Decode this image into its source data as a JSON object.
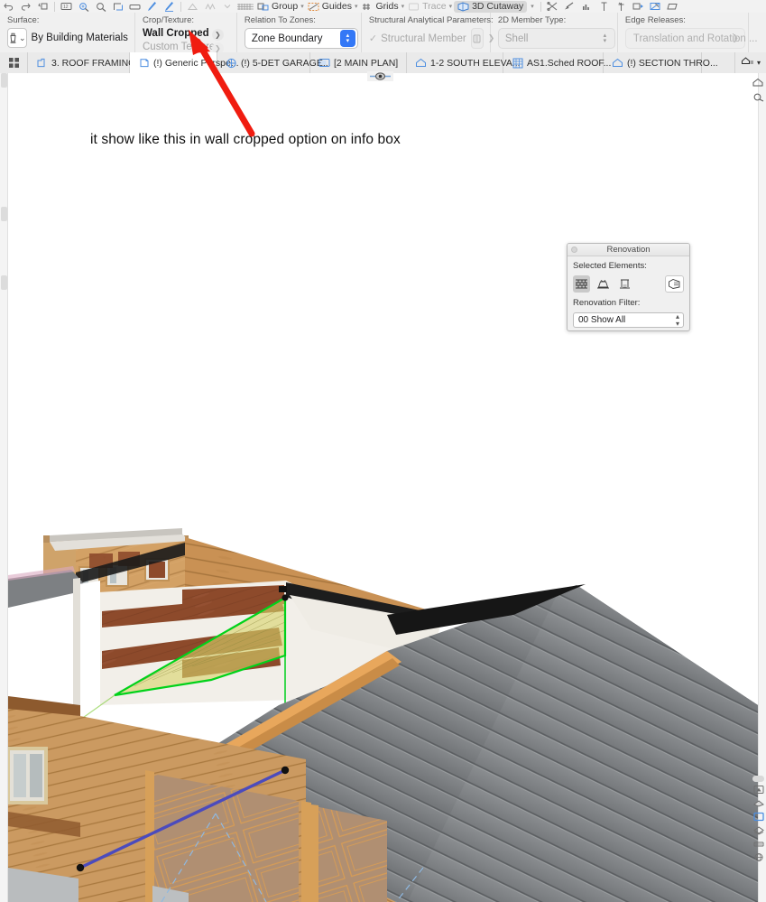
{
  "toolbar": {
    "groups": [
      {
        "label": "Group",
        "icon": "group-icon",
        "has_chevron": true,
        "dim": false
      },
      {
        "label": "Guides",
        "icon": "guides-icon",
        "has_chevron": true,
        "dim": false
      },
      {
        "label": "Grids",
        "icon": "grids-icon",
        "has_chevron": true,
        "dim": false
      },
      {
        "label": "Trace",
        "icon": "trace-icon",
        "has_chevron": true,
        "dim": true
      },
      {
        "label": "3D Cutaway",
        "icon": "cutaway-icon",
        "has_chevron": true,
        "dim": false,
        "active": true
      }
    ],
    "left_icons": [
      "undo-icon",
      "redo-icon",
      "dimension-icon",
      "zoom-fit-icon",
      "zoom-find-icon",
      "marquee-icon",
      "drawer-icon",
      "pen-icon",
      "pen-alt-icon"
    ],
    "mid_icons": [
      "triangle-icon",
      "polyline-icon",
      "chevron-down-icon",
      "hatch-icon"
    ],
    "right_icons": [
      "split-icon",
      "arrow-trim-icon",
      "elevate-icon",
      "offset-icon",
      "multi-offset-icon",
      "filter-icon",
      "hide-icon",
      "folder-icon"
    ]
  },
  "info_box": {
    "panes": [
      {
        "caption": "Surface:",
        "type": "material",
        "chip_icon": "paint-bucket-icon",
        "value": "By Building Materials"
      },
      {
        "caption": "Crop/Texture:",
        "type": "two-links",
        "primary": "Wall Cropped",
        "secondary": "Custom Texture"
      },
      {
        "caption": "Relation To Zones:",
        "type": "popup",
        "value": "Zone Boundary"
      },
      {
        "caption": "Structural Analytical Parameters:",
        "type": "check-with-button",
        "value": "Structural Member",
        "checked": true
      },
      {
        "caption": "2D Member Type:",
        "type": "flat-popup",
        "value": "Shell"
      },
      {
        "caption": "Edge Releases:",
        "type": "flat-link",
        "value": "Translation and Rotation ..."
      }
    ]
  },
  "tabs": {
    "grid_button_icon": "tab-grid-icon",
    "items": [
      {
        "label": "3. ROOF FRAMING...",
        "icon": "story-icon",
        "active": false
      },
      {
        "label": "(!) Generic Perspe...",
        "icon": "perspective-icon",
        "active": true
      },
      {
        "label": "(!) 5-DET GARAGE...",
        "icon": "detail-icon",
        "active": false
      },
      {
        "label": "[2 MAIN PLAN]",
        "icon": "layout-icon",
        "active": false
      },
      {
        "label": "1-2 SOUTH ELEVA...",
        "icon": "elevation-icon",
        "active": false
      },
      {
        "label": "AS1.Sched ROOF...",
        "icon": "schedule-icon",
        "active": false
      },
      {
        "label": "(!) SECTION THRO...",
        "icon": "section-icon",
        "active": false
      }
    ],
    "end_icon": "tab-overflow-icon",
    "end_chevron": "chevron-down-icon"
  },
  "annotation": {
    "text": "it show like this in wall cropped option on info box",
    "arrow_color": "#f01c10"
  },
  "eye_widget": {
    "icon": "eye-viewpoint-icon"
  },
  "renovation_palette": {
    "title": "Renovation",
    "selected_elements_label": "Selected Elements:",
    "buttons": [
      {
        "name": "existing-icon",
        "selected": true
      },
      {
        "name": "demolished-icon",
        "selected": false
      },
      {
        "name": "new-icon",
        "selected": false
      }
    ],
    "override_button": {
      "name": "renovation-override-icon"
    },
    "filter_label": "Renovation Filter:",
    "filter_value": "00 Show All"
  },
  "right_strip": {
    "top_icons": [
      "shell-tool-icon",
      "marker-tool-icon"
    ],
    "icons": [
      "pill-handle",
      "navigate-icon",
      "orbit-icon",
      "window-icon",
      "layers-icon",
      "view-icon",
      "globe-icon"
    ]
  },
  "model": {
    "description": "3D perspective of timber house with gray standing-seam roof",
    "colors": {
      "roof_gray": "#808285",
      "roof_gray_dark": "#6e7174",
      "wood_light": "#d7a263",
      "wood_mid": "#c4894a",
      "wood_dark": "#8c4a2f",
      "grass": "#5fbb31",
      "wall_white": "#f2efe9",
      "selection_green": "#00d21a",
      "selection_blue": "#4b4bbd",
      "dashed_blue": "#8fb8e0",
      "highlight_fill": "#d8d36a"
    }
  }
}
